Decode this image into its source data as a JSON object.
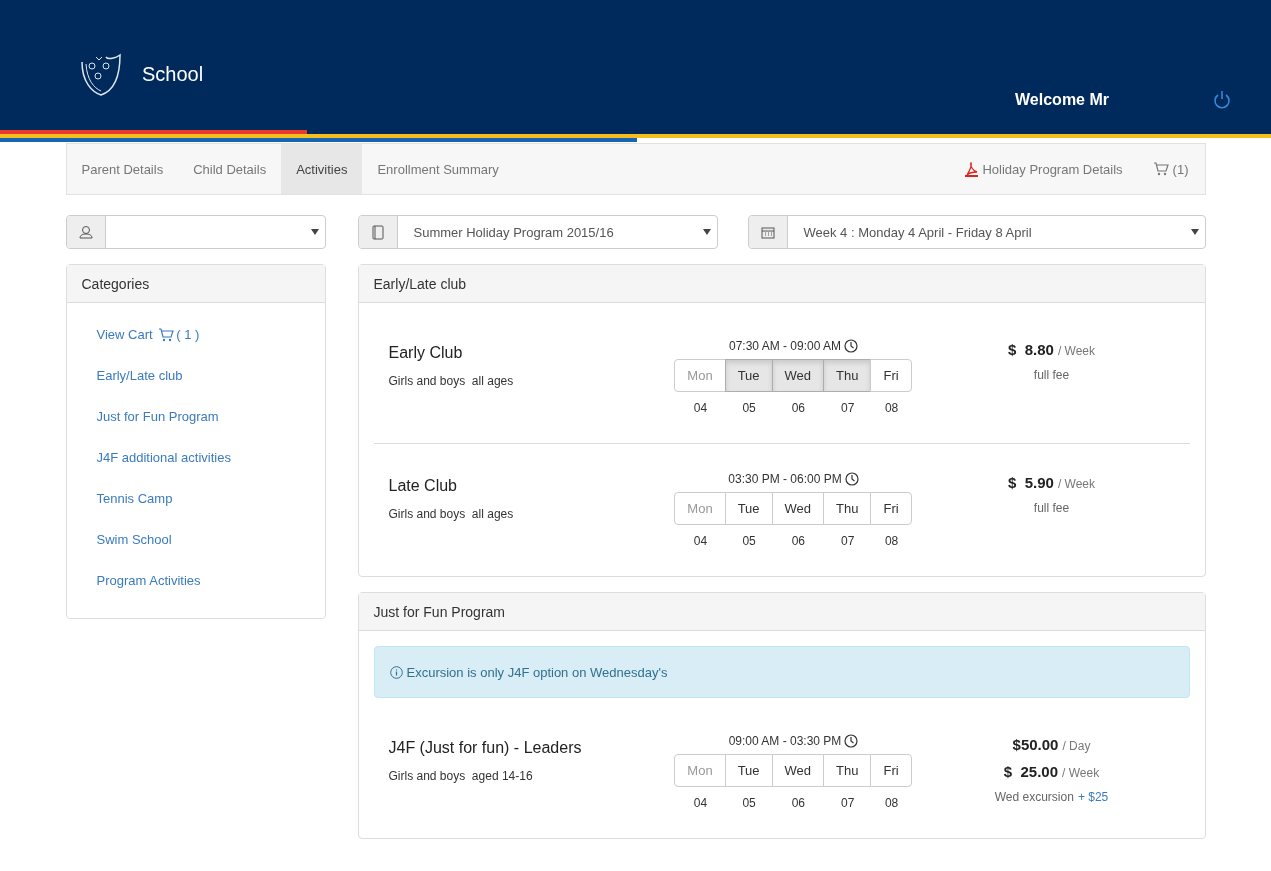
{
  "header": {
    "title": "School",
    "welcome": "Welcome Mr"
  },
  "nav": {
    "tabs": [
      {
        "label": "Parent Details",
        "selected": false
      },
      {
        "label": "Child Details",
        "selected": false
      },
      {
        "label": "Activities",
        "selected": true
      },
      {
        "label": "Enrollment Summary",
        "selected": false
      }
    ],
    "program_details": "Holiday Program Details",
    "cart": "(1)"
  },
  "filters": {
    "program": {
      "value": "Summer Holiday Program 2015/16"
    },
    "week": {
      "value": "Week 4 : Monday 4 April - Friday 8 April"
    }
  },
  "categories": {
    "title": "Categories",
    "view_cart": {
      "label": "View Cart",
      "count": "( 1 )"
    },
    "items": [
      "Early/Late club",
      "Just for Fun Program",
      "J4F additional activities",
      "Tennis Camp",
      "Swim School",
      "Program Activities"
    ]
  },
  "sections": [
    {
      "title": "Early/Late club",
      "activities": [
        {
          "name": "Early Club",
          "audience": "Girls and boys",
          "ages": "all ages",
          "time": "07:30 AM - 09:00 AM",
          "days": [
            {
              "label": "Mon",
              "date": "04",
              "disabled": true,
              "selected": false
            },
            {
              "label": "Tue",
              "date": "05",
              "disabled": false,
              "selected": true
            },
            {
              "label": "Wed",
              "date": "06",
              "disabled": false,
              "selected": true
            },
            {
              "label": "Thu",
              "date": "07",
              "disabled": false,
              "selected": true
            },
            {
              "label": "Fri",
              "date": "08",
              "disabled": false,
              "selected": false
            }
          ],
          "prices": [
            {
              "amount": "$  8.80",
              "unit": "/ Week"
            }
          ],
          "note": {
            "text": "full fee"
          }
        },
        {
          "name": "Late Club",
          "audience": "Girls and boys",
          "ages": "all ages",
          "time": "03:30 PM - 06:00 PM",
          "days": [
            {
              "label": "Mon",
              "date": "04",
              "disabled": true,
              "selected": false
            },
            {
              "label": "Tue",
              "date": "05",
              "disabled": false,
              "selected": false
            },
            {
              "label": "Wed",
              "date": "06",
              "disabled": false,
              "selected": false
            },
            {
              "label": "Thu",
              "date": "07",
              "disabled": false,
              "selected": false
            },
            {
              "label": "Fri",
              "date": "08",
              "disabled": false,
              "selected": false
            }
          ],
          "prices": [
            {
              "amount": "$  5.90",
              "unit": "/ Week"
            }
          ],
          "note": {
            "text": "full fee"
          }
        }
      ]
    },
    {
      "title": "Just for Fun Program",
      "alert": "Excursion is only J4F option on Wednesday's",
      "activities": [
        {
          "name": "J4F (Just for fun) - Leaders",
          "audience": "Girls and boys",
          "ages": "aged 14-16",
          "time": "09:00 AM - 03:30 PM",
          "days": [
            {
              "label": "Mon",
              "date": "04",
              "disabled": true,
              "selected": false
            },
            {
              "label": "Tue",
              "date": "05",
              "disabled": false,
              "selected": false
            },
            {
              "label": "Wed",
              "date": "06",
              "disabled": false,
              "selected": false
            },
            {
              "label": "Thu",
              "date": "07",
              "disabled": false,
              "selected": false
            },
            {
              "label": "Fri",
              "date": "08",
              "disabled": false,
              "selected": false
            }
          ],
          "prices": [
            {
              "amount": "$50.00",
              "unit": "/ Day"
            },
            {
              "amount": "$  25.00",
              "unit": "/ Week"
            }
          ],
          "note": {
            "text": "Wed excursion",
            "link": "+ $25"
          }
        }
      ]
    }
  ]
}
